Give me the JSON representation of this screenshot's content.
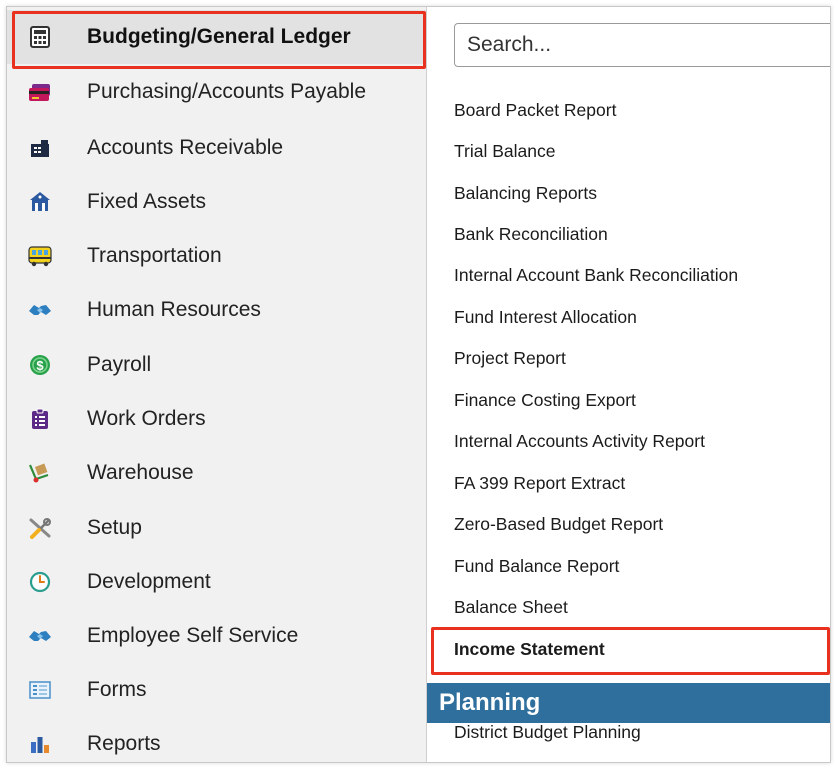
{
  "sidebar": {
    "items": [
      {
        "label": "Budgeting/General Ledger",
        "icon": "calculator-icon"
      },
      {
        "label": "Purchasing/Accounts Payable",
        "icon": "credit-card-icon"
      },
      {
        "label": "Accounts Receivable",
        "icon": "cash-register-icon"
      },
      {
        "label": "Fixed Assets",
        "icon": "building-icon"
      },
      {
        "label": "Transportation",
        "icon": "bus-icon"
      },
      {
        "label": "Human Resources",
        "icon": "handshake-icon"
      },
      {
        "label": "Payroll",
        "icon": "dollar-coin-icon"
      },
      {
        "label": "Work Orders",
        "icon": "clipboard-icon"
      },
      {
        "label": "Warehouse",
        "icon": "dolly-icon"
      },
      {
        "label": "Setup",
        "icon": "tools-icon"
      },
      {
        "label": "Development",
        "icon": "clock-icon"
      },
      {
        "label": "Employee Self Service",
        "icon": "handshake-icon"
      },
      {
        "label": "Forms",
        "icon": "form-icon"
      },
      {
        "label": "Reports",
        "icon": "bar-chart-icon"
      }
    ],
    "active_index": 0
  },
  "search": {
    "placeholder": "Search..."
  },
  "reports": {
    "items": [
      "Board Packet Report",
      "Trial Balance",
      "Balancing Reports",
      "Bank Reconciliation",
      "Internal Account Bank Reconciliation",
      "Fund Interest Allocation",
      "Project Report",
      "Finance Costing Export",
      "Internal Accounts Activity Report",
      "FA 399 Report Extract",
      "Zero-Based Budget Report",
      "Fund Balance Report",
      "Balance Sheet",
      "Income Statement"
    ],
    "highlighted_index": 13
  },
  "planning": {
    "header": "Planning",
    "items": [
      "District Budget Planning"
    ]
  },
  "colors": {
    "highlight": "#e8321f",
    "section_header": "#2f6f9d"
  }
}
